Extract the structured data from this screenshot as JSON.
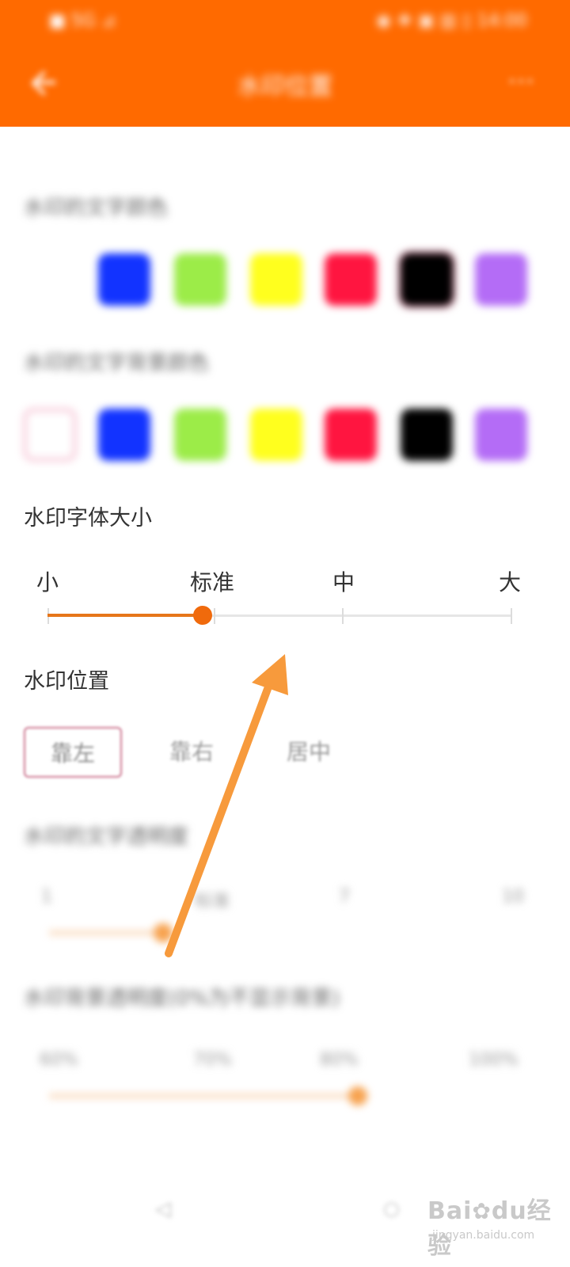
{
  "status_bar": {
    "left": "■ 5G ⊿",
    "right": "◉ ❖ ▣ ▥ ▯ 14:00"
  },
  "header": {
    "title": "水印位置",
    "more": "⋯"
  },
  "color_sections": [
    {
      "label": "水印的文字颜色",
      "swatches": [
        "#1233ff",
        "#9cec48",
        "#ffff1e",
        "#ff1540",
        "#000000",
        "#b46cf6"
      ]
    },
    {
      "label": "水印的文字背景颜色",
      "swatches": [
        "#ffffff",
        "#1233ff",
        "#9cec48",
        "#ffff1e",
        "#ff1540",
        "#000000",
        "#b46cf6"
      ]
    }
  ],
  "font_size": {
    "title": "水印字体大小",
    "ticks": [
      "小",
      "标准",
      "中",
      "大"
    ],
    "selected_index": 1
  },
  "position": {
    "title": "水印位置",
    "options": [
      "靠左",
      "靠右",
      "居中"
    ],
    "selected_index": 0
  },
  "opacity": {
    "label": "水印的文字透明度",
    "ticks": [
      "1",
      "标准",
      "7",
      "10"
    ]
  },
  "bg_opacity": {
    "label": "水印背景透明度(0%为不显示背景)",
    "ticks": [
      "60%",
      "70%",
      "80%",
      "100%"
    ]
  },
  "nav": {
    "back": "◁",
    "home": "○"
  },
  "watermark": {
    "brand": "Bai",
    "brand2": "du",
    "suffix": "经验",
    "url": "jingyan.baidu.com"
  },
  "colors": {
    "header": "#ff6a00",
    "accent": "#e6761a",
    "arrow": "#f79a3c"
  }
}
